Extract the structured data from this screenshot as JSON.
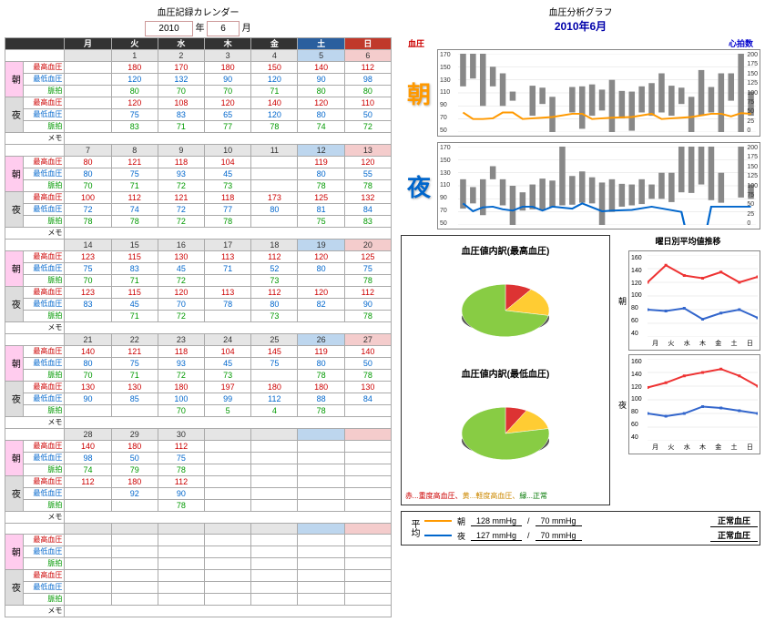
{
  "cal": {
    "title": "血圧記録カレンダー",
    "year": "2010",
    "ylabel": "年",
    "month": "6",
    "mlabel": "月",
    "dow": [
      "月",
      "火",
      "水",
      "木",
      "金",
      "土",
      "日"
    ],
    "rowlabels": {
      "sys": "最高血圧",
      "dia": "最低血圧",
      "pulse": "脈拍",
      "memo": "メモ"
    },
    "side": {
      "morn": "朝",
      "night": "夜"
    },
    "weeks": [
      {
        "days": [
          "",
          "1",
          "2",
          "3",
          "4",
          "5",
          "6"
        ],
        "morn": {
          "sys": [
            "",
            "180",
            "170",
            "180",
            "150",
            "140",
            "112"
          ],
          "dia": [
            "",
            "120",
            "132",
            "90",
            "120",
            "90",
            "98"
          ],
          "pulse": [
            "",
            "80",
            "70",
            "70",
            "71",
            "80",
            "80"
          ]
        },
        "night": {
          "sys": [
            "",
            "120",
            "108",
            "120",
            "140",
            "120",
            "110"
          ],
          "dia": [
            "",
            "75",
            "83",
            "65",
            "120",
            "80",
            "50"
          ],
          "pulse": [
            "",
            "83",
            "71",
            "77",
            "78",
            "74",
            "72"
          ]
        }
      },
      {
        "days": [
          "7",
          "8",
          "9",
          "10",
          "11",
          "12",
          "13"
        ],
        "morn": {
          "sys": [
            "80",
            "121",
            "118",
            "104",
            "",
            "119",
            "120"
          ],
          "dia": [
            "80",
            "75",
            "93",
            "45",
            "",
            "80",
            "55"
          ],
          "pulse": [
            "70",
            "71",
            "72",
            "73",
            "",
            "78",
            "78"
          ]
        },
        "night": {
          "sys": [
            "100",
            "112",
            "121",
            "118",
            "173",
            "125",
            "132"
          ],
          "dia": [
            "72",
            "74",
            "72",
            "77",
            "80",
            "81",
            "84"
          ],
          "pulse": [
            "78",
            "78",
            "72",
            "78",
            "",
            "75",
            "83"
          ]
        }
      },
      {
        "days": [
          "14",
          "15",
          "16",
          "17",
          "18",
          "19",
          "20"
        ],
        "morn": {
          "sys": [
            "123",
            "115",
            "130",
            "113",
            "112",
            "120",
            "125"
          ],
          "dia": [
            "75",
            "83",
            "45",
            "71",
            "52",
            "80",
            "75"
          ],
          "pulse": [
            "70",
            "71",
            "72",
            "",
            "73",
            "",
            "78"
          ]
        },
        "night": {
          "sys": [
            "123",
            "115",
            "120",
            "113",
            "112",
            "120",
            "112"
          ],
          "dia": [
            "83",
            "45",
            "70",
            "78",
            "80",
            "82",
            "90"
          ],
          "pulse": [
            "",
            "71",
            "72",
            "",
            "73",
            "",
            "78"
          ]
        }
      },
      {
        "days": [
          "21",
          "22",
          "23",
          "24",
          "25",
          "26",
          "27"
        ],
        "morn": {
          "sys": [
            "140",
            "121",
            "118",
            "104",
            "145",
            "119",
            "140"
          ],
          "dia": [
            "80",
            "75",
            "93",
            "45",
            "75",
            "80",
            "50"
          ],
          "pulse": [
            "70",
            "71",
            "72",
            "73",
            "",
            "78",
            "78"
          ]
        },
        "night": {
          "sys": [
            "130",
            "130",
            "180",
            "197",
            "180",
            "180",
            "130"
          ],
          "dia": [
            "90",
            "85",
            "100",
            "99",
            "112",
            "88",
            "84"
          ],
          "pulse": [
            "",
            "",
            "70",
            "5",
            "4",
            "78",
            ""
          ]
        }
      },
      {
        "days": [
          "28",
          "29",
          "30",
          "",
          "",
          "",
          ""
        ],
        "morn": {
          "sys": [
            "140",
            "180",
            "112",
            "",
            "",
            "",
            ""
          ],
          "dia": [
            "98",
            "50",
            "75",
            "",
            "",
            "",
            ""
          ],
          "pulse": [
            "74",
            "79",
            "78",
            "",
            "",
            "",
            ""
          ]
        },
        "night": {
          "sys": [
            "112",
            "180",
            "112",
            "",
            "",
            "",
            ""
          ],
          "dia": [
            "",
            "92",
            "90",
            "",
            "",
            "",
            ""
          ],
          "pulse": [
            "",
            "",
            "78",
            "",
            "",
            "",
            ""
          ]
        }
      },
      {
        "days": [
          "",
          "",
          "",
          "",
          "",
          "",
          ""
        ],
        "morn": {
          "sys": [
            "",
            "",
            "",
            "",
            "",
            "",
            ""
          ],
          "dia": [
            "",
            "",
            "",
            "",
            "",
            "",
            ""
          ],
          "pulse": [
            "",
            "",
            "",
            "",
            "",
            "",
            ""
          ]
        },
        "night": {
          "sys": [
            "",
            "",
            "",
            "",
            "",
            "",
            ""
          ],
          "dia": [
            "",
            "",
            "",
            "",
            "",
            "",
            ""
          ],
          "pulse": [
            "",
            "",
            "",
            "",
            "",
            "",
            ""
          ]
        }
      }
    ]
  },
  "ana": {
    "title": "血圧分析グラフ",
    "date": "2010年6月",
    "hdr_l": "血圧",
    "hdr_r": "心拍数",
    "morn_lbl": "朝",
    "night_lbl": "夜"
  },
  "chart_data": [
    {
      "type": "bar",
      "name": "morning_bp",
      "ylim_left": [
        50,
        170
      ],
      "yticks_left": [
        50,
        70,
        90,
        110,
        130,
        150,
        170
      ],
      "ylim_right": [
        0,
        200
      ],
      "yticks_right": [
        0,
        25,
        50,
        75,
        100,
        125,
        150,
        175,
        200
      ],
      "x": [
        1,
        2,
        3,
        4,
        5,
        6,
        7,
        8,
        9,
        10,
        11,
        12,
        13,
        14,
        15,
        16,
        17,
        18,
        19,
        20,
        21,
        22,
        23,
        24,
        25,
        26,
        27,
        28,
        29,
        30
      ],
      "sys": [
        180,
        170,
        180,
        150,
        140,
        112,
        80,
        121,
        118,
        104,
        null,
        119,
        120,
        123,
        115,
        130,
        113,
        112,
        120,
        125,
        140,
        121,
        118,
        104,
        145,
        119,
        140,
        140,
        180,
        112
      ],
      "dia": [
        120,
        132,
        90,
        120,
        90,
        98,
        80,
        75,
        93,
        45,
        null,
        80,
        55,
        75,
        83,
        45,
        71,
        52,
        80,
        75,
        80,
        75,
        93,
        45,
        75,
        80,
        50,
        98,
        50,
        75
      ],
      "pulse": [
        80,
        70,
        70,
        71,
        80,
        80,
        70,
        71,
        72,
        73,
        null,
        78,
        78,
        70,
        71,
        72,
        null,
        73,
        null,
        78,
        70,
        71,
        72,
        73,
        null,
        78,
        78,
        74,
        79,
        78
      ]
    },
    {
      "type": "bar",
      "name": "night_bp",
      "ylim_left": [
        50,
        170
      ],
      "yticks_left": [
        50,
        70,
        90,
        110,
        130,
        150,
        170
      ],
      "ylim_right": [
        0,
        200
      ],
      "yticks_right": [
        0,
        25,
        50,
        75,
        100,
        125,
        150,
        175,
        200
      ],
      "x": [
        1,
        2,
        3,
        4,
        5,
        6,
        7,
        8,
        9,
        10,
        11,
        12,
        13,
        14,
        15,
        16,
        17,
        18,
        19,
        20,
        21,
        22,
        23,
        24,
        25,
        26,
        27,
        28,
        29,
        30
      ],
      "sys": [
        120,
        108,
        120,
        140,
        120,
        110,
        100,
        112,
        121,
        118,
        173,
        125,
        132,
        123,
        115,
        120,
        113,
        112,
        120,
        112,
        130,
        130,
        180,
        197,
        180,
        180,
        130,
        112,
        180,
        112
      ],
      "dia": [
        75,
        83,
        65,
        120,
        80,
        50,
        72,
        74,
        72,
        77,
        80,
        81,
        84,
        83,
        45,
        70,
        78,
        80,
        82,
        90,
        90,
        85,
        100,
        99,
        112,
        88,
        84,
        null,
        92,
        90
      ],
      "pulse": [
        83,
        71,
        77,
        78,
        74,
        72,
        78,
        78,
        72,
        78,
        null,
        75,
        83,
        null,
        71,
        72,
        null,
        73,
        null,
        78,
        null,
        null,
        70,
        5,
        4,
        78,
        null,
        null,
        null,
        78
      ]
    },
    {
      "type": "pie",
      "name": "sys_breakdown",
      "title": "血圧値内訳(最高血圧)",
      "slices": [
        {
          "label": "重度高血圧",
          "value": 10,
          "color": "#d33"
        },
        {
          "label": "軽度高血圧",
          "value": 18,
          "color": "#fc3"
        },
        {
          "label": "正常",
          "value": 72,
          "color": "#8c4"
        }
      ]
    },
    {
      "type": "pie",
      "name": "dia_breakdown",
      "title": "血圧値内訳(最低血圧)",
      "slices": [
        {
          "label": "重度高血圧",
          "value": 8,
          "color": "#d33"
        },
        {
          "label": "軽度高血圧",
          "value": 14,
          "color": "#fc3"
        },
        {
          "label": "正常",
          "value": 78,
          "color": "#8c4"
        }
      ]
    },
    {
      "type": "line",
      "name": "dow_morning",
      "title": "曜日別平均値推移",
      "categories": [
        "月",
        "火",
        "水",
        "木",
        "金",
        "土",
        "日"
      ],
      "ylim": [
        40,
        160
      ],
      "yticks": [
        40,
        60,
        80,
        100,
        120,
        140,
        160
      ],
      "series": [
        {
          "name": "最高",
          "color": "#e33",
          "values": [
            120,
            145,
            130,
            126,
            135,
            120,
            128
          ]
        },
        {
          "name": "最低",
          "color": "#36c",
          "values": [
            80,
            78,
            82,
            66,
            75,
            80,
            68
          ]
        }
      ]
    },
    {
      "type": "line",
      "name": "dow_night",
      "categories": [
        "月",
        "火",
        "水",
        "木",
        "金",
        "土",
        "日"
      ],
      "ylim": [
        40,
        160
      ],
      "yticks": [
        40,
        60,
        80,
        100,
        120,
        140,
        160
      ],
      "series": [
        {
          "name": "最高",
          "color": "#e33",
          "values": [
            118,
            125,
            135,
            140,
            145,
            135,
            120
          ]
        },
        {
          "name": "最低",
          "color": "#36c",
          "values": [
            80,
            76,
            80,
            90,
            88,
            84,
            80
          ]
        }
      ]
    }
  ],
  "pie_legend": {
    "r": "赤...重度高血圧、",
    "y": "黄...軽度高血圧、",
    "g": "緑...正常"
  },
  "dow_title": "曜日別平均値推移",
  "avg": {
    "label": "平均",
    "rows": [
      {
        "name": "朝",
        "color": "#f90",
        "sys": "128 mmHg",
        "dia": "70 mmHg",
        "status": "正常血圧"
      },
      {
        "name": "夜",
        "color": "#06c",
        "sys": "127 mmHg",
        "dia": "70 mmHg",
        "status": "正常血圧"
      }
    ]
  }
}
